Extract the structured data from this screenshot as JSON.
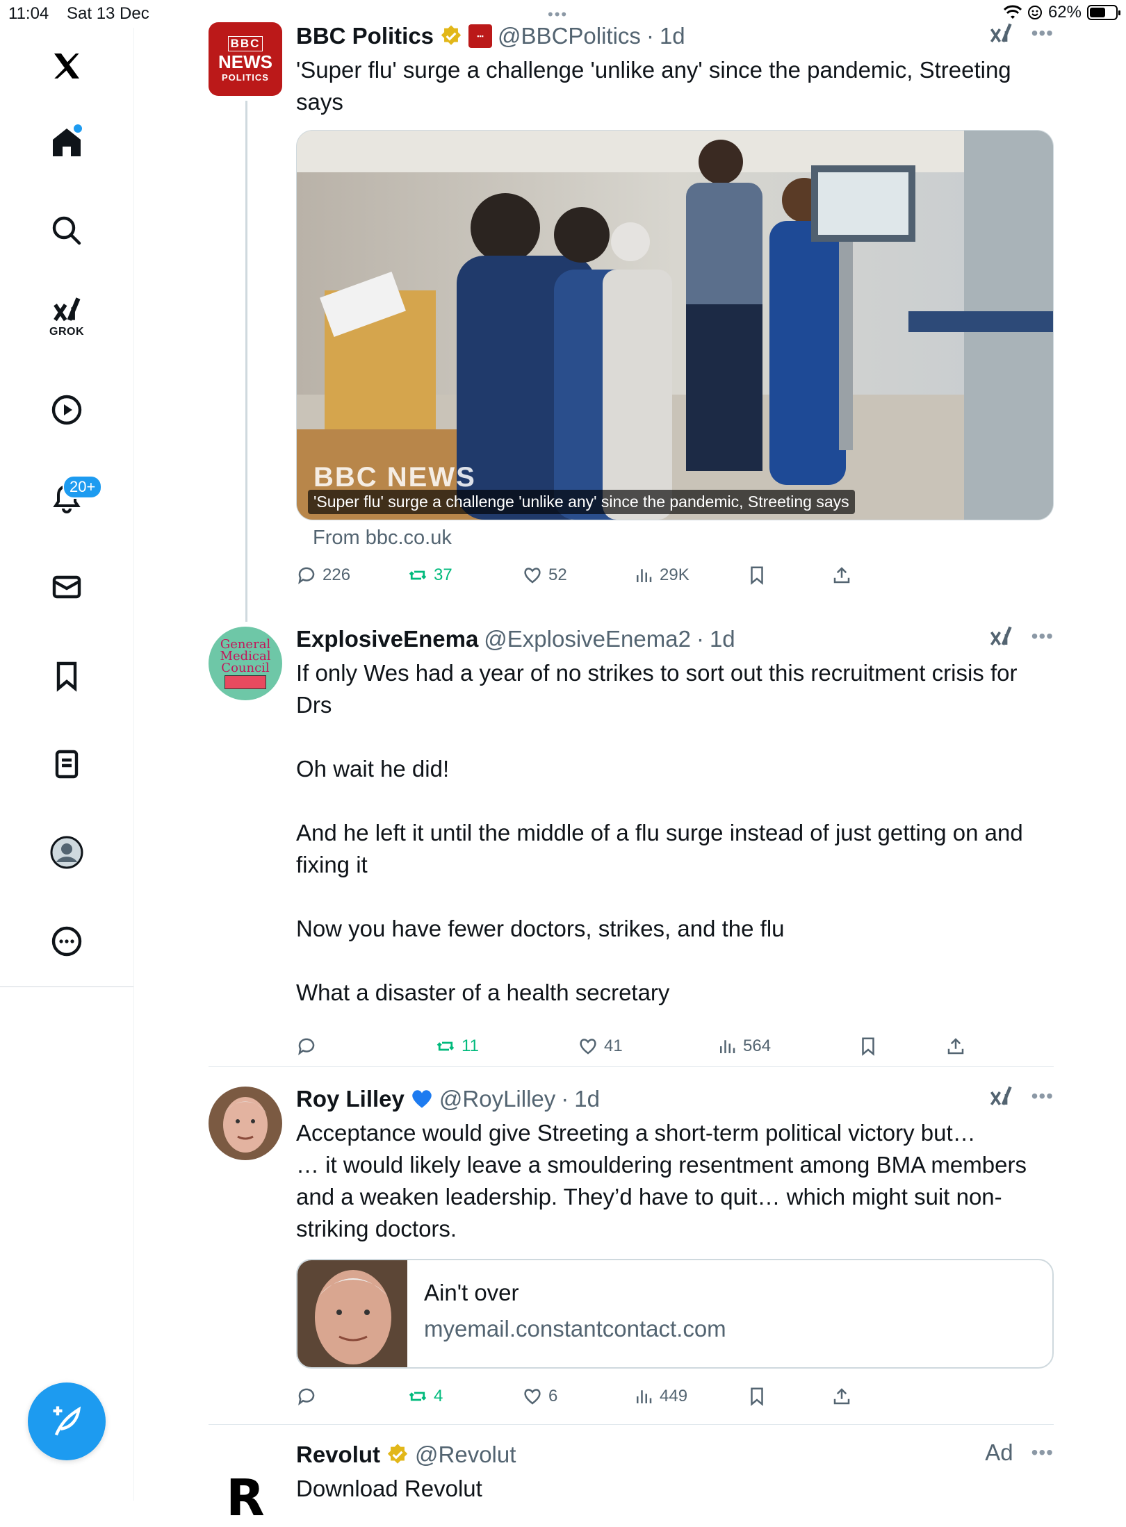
{
  "status_bar": {
    "time": "11:04",
    "date": "Sat 13 Dec",
    "battery": "62%",
    "battery_level": 0.62
  },
  "sidebar": {
    "grok_label": "GROK",
    "notification_count": "20+"
  },
  "posts": [
    {
      "name": "BBC Politics",
      "handle": "@BBCPolitics",
      "dot": "·",
      "time": "1d",
      "avatar_text": {
        "line1": "BBC",
        "line2": "NEWS",
        "line3": "POLITICS"
      },
      "text": "'Super flu' surge a challenge 'unlike any' since the pandemic, Streeting says",
      "media": {
        "watermark": "BBC NEWS",
        "caption": "'Super flu' surge a challenge 'unlike any' since the pandemic, Streeting says"
      },
      "from": "From bbc.co.uk",
      "stats": {
        "replies": "226",
        "reposts": "37",
        "likes": "52",
        "views": "29K"
      }
    },
    {
      "name": "ExplosiveEnema",
      "handle": "@ExplosiveEnema2",
      "dot": "·",
      "time": "1d",
      "avatar_text": {
        "line1": "General",
        "line2": "Medical",
        "line3": "Council"
      },
      "text": "If only Wes had a year of no strikes to sort out this recruitment crisis for Drs\n\nOh wait he did!\n\nAnd he left it until the middle of a flu surge instead of just getting on and fixing it\n\nNow you have fewer doctors, strikes, and the flu\n\nWhat a disaster of a health secretary",
      "stats": {
        "replies": "",
        "reposts": "11",
        "likes": "41",
        "views": "564"
      }
    },
    {
      "name": "Roy Lilley",
      "handle": "@RoyLilley",
      "dot": "·",
      "time": "1d",
      "text": "Acceptance would give Streeting a short-term political victory but…\n… it would likely leave a smouldering resentment among BMA members and a weaken leadership. They’d have to quit… which might suit non-striking doctors.",
      "card": {
        "title": "Ain't over",
        "domain": "myemail.constantcontact.com"
      },
      "stats": {
        "replies": "",
        "reposts": "4",
        "likes": "6",
        "views": "449"
      }
    },
    {
      "name": "Revolut",
      "handle": "@Revolut",
      "ad_label": "Ad",
      "text": "Download Revolut"
    }
  ],
  "colors": {
    "accent": "#1d9bf0",
    "repost": "#00ba7c",
    "muted": "#536471",
    "verified_gold": "#e2b719",
    "bbc_red": "#bb1919"
  }
}
